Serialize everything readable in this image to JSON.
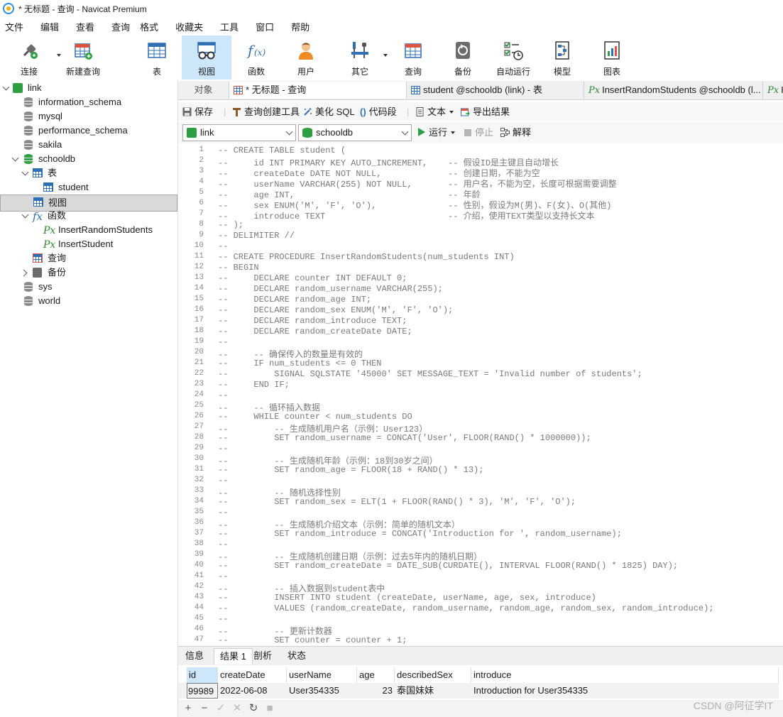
{
  "window": {
    "title": "* 无标题 - 查询 - Navicat Premium"
  },
  "menu": [
    "文件",
    "编辑",
    "查看",
    "查询",
    "格式",
    "收藏夹",
    "工具",
    "窗口",
    "帮助"
  ],
  "toolbar": {
    "connect": "连接",
    "new_query": "新建查询",
    "table": "表",
    "view": "视图",
    "function": "函数",
    "user": "用户",
    "other": "其它",
    "query": "查询",
    "backup": "备份",
    "automation": "自动运行",
    "model": "模型",
    "chart": "图表"
  },
  "sidebar": {
    "connection": "link",
    "databases": [
      "information_schema",
      "mysql",
      "performance_schema",
      "sakila"
    ],
    "schooldb": "schooldb",
    "tables_group": "表",
    "table_student": "student",
    "views_group": "视图",
    "functions_group": "函数",
    "func1": "InsertRandomStudents",
    "func2": "InsertStudent",
    "queries_group": "查询",
    "backups_group": "备份",
    "databases_after": [
      "sys",
      "world"
    ]
  },
  "tabs": {
    "objects": "对象",
    "query": "* 无标题 - 查询",
    "student": "student @schooldb (link) - 表",
    "insert_random": "InsertRandomStudents @schooldb (l...",
    "partial": "Ir"
  },
  "query_toolbar": {
    "save": "保存",
    "builder": "查询创建工具",
    "beautify": "美化 SQL",
    "snippet": "代码段",
    "text": "文本",
    "export": "导出结果"
  },
  "selectors": {
    "connection": "link",
    "database": "schooldb",
    "run": "运行",
    "stop": "停止",
    "explain": "解释"
  },
  "editor": {
    "lines": [
      "-- CREATE TABLE student (",
      "--     id INT PRIMARY KEY AUTO_INCREMENT,    -- 假设ID是主键且自动增长",
      "--     createDate DATE NOT NULL,             -- 创建日期，不能为空",
      "--     userName VARCHAR(255) NOT NULL,       -- 用户名，不能为空，长度可根据需要调整",
      "--     age INT,                              -- 年龄",
      "--     sex ENUM('M', 'F', 'O'),              -- 性别，假设为M(男)、F(女)、O(其他)",
      "--     introduce TEXT                        -- 介绍，使用TEXT类型以支持长文本",
      "-- );",
      "-- DELIMITER //",
      "--",
      "-- CREATE PROCEDURE InsertRandomStudents(num_students INT)",
      "-- BEGIN",
      "--     DECLARE counter INT DEFAULT 0;",
      "--     DECLARE random_username VARCHAR(255);",
      "--     DECLARE random_age INT;",
      "--     DECLARE random_sex ENUM('M', 'F', 'O');",
      "--     DECLARE random_introduce TEXT;",
      "--     DECLARE random_createDate DATE;",
      "--",
      "--     -- 确保传入的数量是有效的",
      "--     IF num_students <= 0 THEN",
      "--         SIGNAL SQLSTATE '45000' SET MESSAGE_TEXT = 'Invalid number of students';",
      "--     END IF;",
      "--",
      "--     -- 循环插入数据",
      "--     WHILE counter < num_students DO",
      "--         -- 生成随机用户名（示例：User123）",
      "--         SET random_username = CONCAT('User', FLOOR(RAND() * 1000000));",
      "--",
      "--         -- 生成随机年龄（示例：18到30岁之间）",
      "--         SET random_age = FLOOR(18 + RAND() * 13);",
      "--",
      "--         -- 随机选择性别",
      "--         SET random_sex = ELT(1 + FLOOR(RAND() * 3), 'M', 'F', 'O');",
      "--",
      "--         -- 生成随机介绍文本（示例：简单的随机文本）",
      "--         SET random_introduce = CONCAT('Introduction for ', random_username);",
      "--",
      "--         -- 生成随机创建日期（示例：过去5年内的随机日期）",
      "--         SET random_createDate = DATE_SUB(CURDATE(), INTERVAL FLOOR(RAND() * 1825) DAY);",
      "--",
      "--         -- 插入数据到student表中",
      "--         INSERT INTO student (createDate, userName, age, sex, introduce)",
      "--         VALUES (random_createDate, random_username, random_age, random_sex, random_introduce);",
      "--",
      "--         -- 更新计数器",
      "--         SET counter = counter + 1;"
    ]
  },
  "result_tabs": [
    "信息",
    "结果 1",
    "剖析",
    "状态"
  ],
  "grid": {
    "columns": [
      "id",
      "createDate",
      "userName",
      "age",
      "describedSex",
      "introduce"
    ],
    "row": [
      "99989",
      "2022-06-08",
      "User354335",
      "23",
      "泰国妹妹",
      "Introduction for User354335"
    ]
  },
  "watermark": "CSDN @阿征学IT"
}
